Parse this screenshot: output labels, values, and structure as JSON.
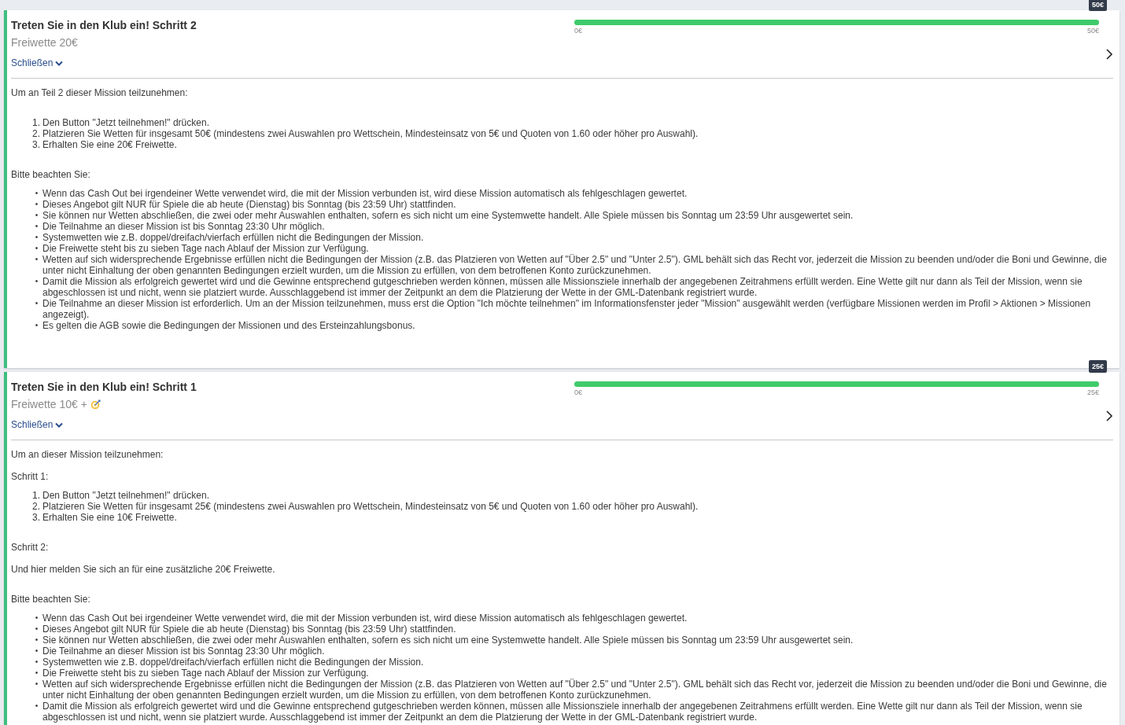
{
  "missions": [
    {
      "title": "Treten Sie in den Klub ein! Schritt 2",
      "reward": "Freiwette 20€",
      "reward_icon": false,
      "toggle": "Schließen",
      "expanded": true,
      "progress": {
        "level": 1,
        "min": "0€",
        "max": "50€",
        "tooltip": "50€"
      },
      "sections": [
        [
          {
            "kind": "text",
            "text": "Um an Teil 2 dieser Mission teilzunehmen:"
          }
        ],
        [
          {
            "kind": "ol",
            "items": [
              {
                "marker": "1.",
                "text": "Den Button \"Jetzt teilnehmen!\" drücken."
              },
              {
                "marker": "2.",
                "text": "Platzieren Sie Wetten für insgesamt 50€ (mindestens zwei Auswahlen pro Wettschein, Mindesteinsatz von 5€ und Quoten von 1.60 oder höher pro Auswahl)."
              },
              {
                "marker": "3.",
                "text": "Erhalten Sie eine 20€ Freiwette."
              }
            ]
          }
        ],
        [
          {
            "kind": "text",
            "text": "Bitte beachten Sie:"
          },
          {
            "kind": "ul",
            "items": [
              {
                "marker": "•",
                "text": "Wenn das Cash Out bei irgendeiner Wette verwendet wird, die mit der Mission verbunden ist, wird diese Mission automatisch als fehlgeschlagen gewertet."
              },
              {
                "marker": "•",
                "text": "Dieses Angebot gilt NUR für Spiele die ab heute (Dienstag) bis Sonntag (bis 23:59 Uhr) stattfinden."
              },
              {
                "marker": "•",
                "text": "Sie können nur Wetten abschließen, die zwei oder mehr Auswahlen enthalten, sofern es sich nicht um eine Systemwette handelt. Alle Spiele müssen bis Sonntag um 23:59 Uhr ausgewertet sein."
              },
              {
                "marker": "•",
                "text": "Die Teilnahme an dieser Mission ist bis Sonntag 23:30 Uhr möglich."
              },
              {
                "marker": "•",
                "text": "Systemwetten wie z.B. doppel/dreifach/vierfach erfüllen nicht die Bedingungen der Mission."
              },
              {
                "marker": "•",
                "text": "Die Freiwette steht bis zu sieben Tage nach Ablauf der Mission zur Verfügung."
              },
              {
                "marker": "•",
                "text": "Wetten auf sich widersprechende Ergebnisse erfüllen nicht die Bedingungen der Mission (z.B. das Platzieren von Wetten auf \"Über 2.5\" und \"Unter 2.5\"). GML behält sich das Recht vor, jederzeit die Mission zu beenden und/oder die Boni und Gewinne, die unter nicht Einhaltung der oben genannten Bedingungen erzielt wurden, um die Mission zu erfüllen, von dem betroffenen Konto zurückzunehmen."
              },
              {
                "marker": "•",
                "text": "Damit die Mission als erfolgreich gewertet wird und die Gewinne entsprechend gutgeschrieben werden können, müssen alle Missionsziele innerhalb der angegebenen Zeitrahmens erfüllt werden. Eine Wette gilt nur dann als Teil der Mission, wenn sie abgeschlossen ist und nicht, wenn sie platziert wurde. Ausschlaggebend ist immer der Zeitpunkt an dem die Platzierung der Wette in der GML-Datenbank registriert wurde."
              },
              {
                "marker": "•",
                "text": "Die Teilnahme an dieser Mission ist erforderlich. Um an der Mission teilzunehmen, muss erst die Option \"Ich möchte teilnehmen\" im Informationsfenster jeder \"Mission\" ausgewählt werden (verfügbare Missionen werden im Profil > Aktionen > Missionen angezeigt)."
              },
              {
                "marker": "•",
                "text": "Es gelten die AGB sowie die Bedingungen der Missionen und des Ersteinzahlungsbonus."
              }
            ]
          }
        ]
      ]
    },
    {
      "title": "Treten Sie in den Klub ein! Schritt 1",
      "reward": "Freiwette 10€ +",
      "reward_icon": true,
      "toggle": "Schließen",
      "expanded": true,
      "progress": {
        "level": 1,
        "min": "0€",
        "max": "25€",
        "tooltip": "25€"
      },
      "sections": [
        [
          {
            "kind": "text",
            "text": "Um an dieser Mission teilzunehmen:"
          },
          {
            "kind": "text",
            "text": "Schritt 1:"
          },
          {
            "kind": "ol",
            "items": [
              {
                "marker": "1.",
                "text": "Den Button \"Jetzt teilnehmen!\" drücken."
              },
              {
                "marker": "2.",
                "text": "Platzieren Sie Wetten für insgesamt 25€ (mindestens zwei Auswahlen pro Wettschein, Mindesteinsatz von 5€ und Quoten von 1.60 oder höher pro Auswahl)."
              },
              {
                "marker": "3.",
                "text": "Erhalten Sie eine 10€ Freiwette."
              }
            ]
          }
        ],
        [
          {
            "kind": "text",
            "text": "Schritt 2:"
          },
          {
            "kind": "text",
            "text": "Und hier melden Sie sich an für eine zusätzliche 20€ Freiwette."
          }
        ],
        [
          {
            "kind": "text",
            "text": "Bitte beachten Sie:"
          },
          {
            "kind": "ul",
            "items": [
              {
                "marker": "•",
                "text": "Wenn das Cash Out bei irgendeiner Wette verwendet wird, die mit der Mission verbunden ist, wird diese Mission automatisch als fehlgeschlagen gewertet."
              },
              {
                "marker": "•",
                "text": "Dieses Angebot gilt NUR für Spiele die ab heute (Dienstag) bis Sonntag (bis 23:59 Uhr) stattfinden."
              },
              {
                "marker": "•",
                "text": "Sie können nur Wetten abschließen, die zwei oder mehr Auswahlen enthalten, sofern es sich nicht um eine Systemwette handelt. Alle Spiele müssen bis Sonntag um 23:59 Uhr ausgewertet sein."
              },
              {
                "marker": "•",
                "text": "Die Teilnahme an dieser Mission ist bis Sonntag 23:30 Uhr möglich."
              },
              {
                "marker": "•",
                "text": "Systemwetten wie z.B. doppel/dreifach/vierfach erfüllen nicht die Bedingungen der Mission."
              },
              {
                "marker": "•",
                "text": "Die Freiwette steht bis zu sieben Tage nach Ablauf der Mission zur Verfügung."
              },
              {
                "marker": "•",
                "text": "Wetten auf sich widersprechende Ergebnisse erfüllen nicht die Bedingungen der Mission (z.B. das Platzieren von Wetten auf \"Über 2.5\" und \"Unter 2.5\"). GML behält sich das Recht vor, jederzeit die Mission zu beenden und/oder die Boni und Gewinne, die unter nicht Einhaltung der oben genannten Bedingungen erzielt wurden, um die Mission zu erfüllen, von dem betroffenen Konto zurückzunehmen."
              },
              {
                "marker": "•",
                "text": "Damit die Mission als erfolgreich gewertet wird und die Gewinne entsprechend gutgeschrieben werden können, müssen alle Missionsziele innerhalb der angegebenen Zeitrahmens erfüllt werden. Eine Wette gilt nur dann als Teil der Mission, wenn sie abgeschlossen ist und nicht, wenn sie platziert wurde. Ausschlaggebend ist immer der Zeitpunkt an dem die Platzierung der Wette in der GML-Datenbank registriert wurde."
              }
            ]
          }
        ]
      ]
    }
  ]
}
